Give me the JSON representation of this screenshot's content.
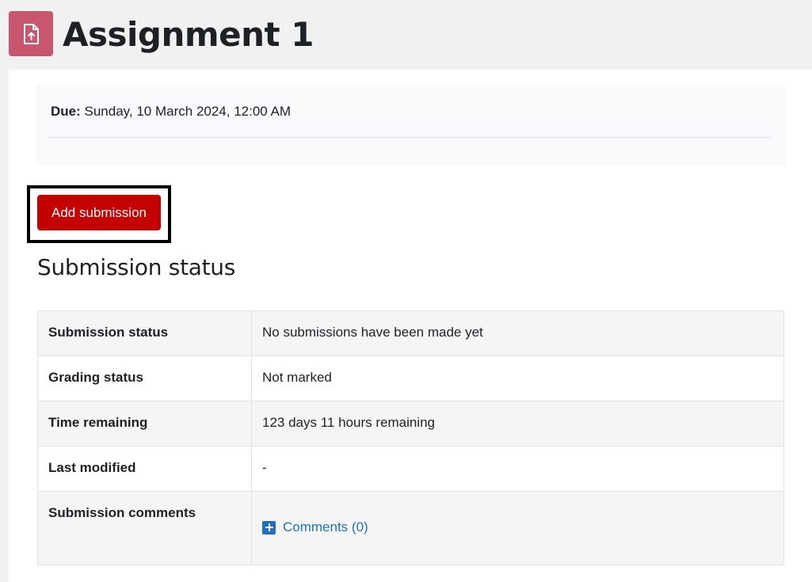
{
  "header": {
    "icon": "assignment-upload-icon",
    "icon_color": "#c8566e",
    "title": "Assignment 1"
  },
  "dates": {
    "due_label": "Due:",
    "due_value": "Sunday, 10 March 2024, 12:00 AM"
  },
  "actions": {
    "add_submission_label": "Add submission",
    "button_color": "#c50000"
  },
  "submission_status": {
    "heading": "Submission status",
    "rows": [
      {
        "label": "Submission status",
        "value": "No submissions have been made yet"
      },
      {
        "label": "Grading status",
        "value": "Not marked"
      },
      {
        "label": "Time remaining",
        "value": "123 days 11 hours remaining"
      },
      {
        "label": "Last modified",
        "value": "-"
      },
      {
        "label": "Submission comments",
        "value": "Comments (0)"
      }
    ]
  },
  "colors": {
    "link": "#1f6fbd"
  }
}
